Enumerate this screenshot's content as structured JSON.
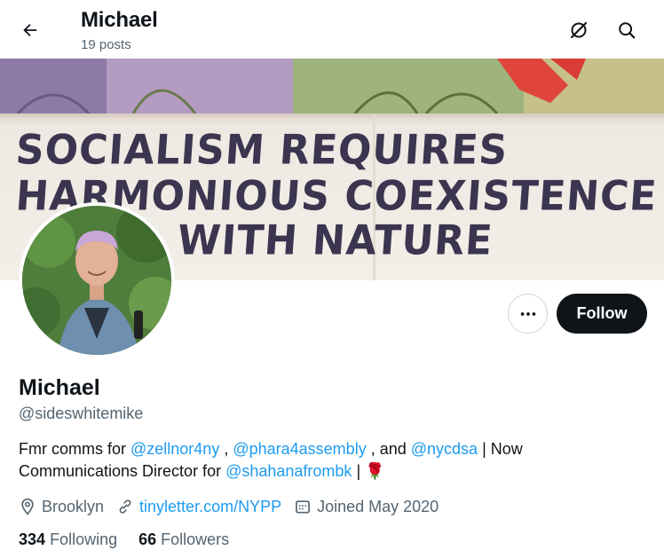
{
  "header": {
    "name": "Michael",
    "posts": "19 posts"
  },
  "banner": {
    "line1": "SOCIALISM REQUIRES",
    "line2": "HARMONIOUS COEXISTENCE",
    "line3": "WITH NATURE"
  },
  "actions": {
    "follow_label": "Follow"
  },
  "profile": {
    "name": "Michael",
    "handle": "@sideswhitemike",
    "bio": {
      "t1": "Fmr comms for ",
      "m1": "@zellnor4ny",
      "t2": " , ",
      "m2": "@phara4assembly",
      "t3": " , and ",
      "m3": "@nycdsa",
      "t4": " | Now Communications Director for ",
      "m4": "@shahanafrombk",
      "t5": " | ",
      "emoji": "🌹"
    },
    "location": "Brooklyn",
    "website": "tinyletter.com/NYPP",
    "joined": "Joined May 2020"
  },
  "stats": {
    "following_count": "334",
    "following_label": "Following",
    "followers_count": "66",
    "followers_label": "Followers"
  },
  "colors": {
    "accent": "#1d9bf0",
    "text": "#0f1419",
    "muted": "#536471",
    "follow_button": "#0f1419"
  }
}
